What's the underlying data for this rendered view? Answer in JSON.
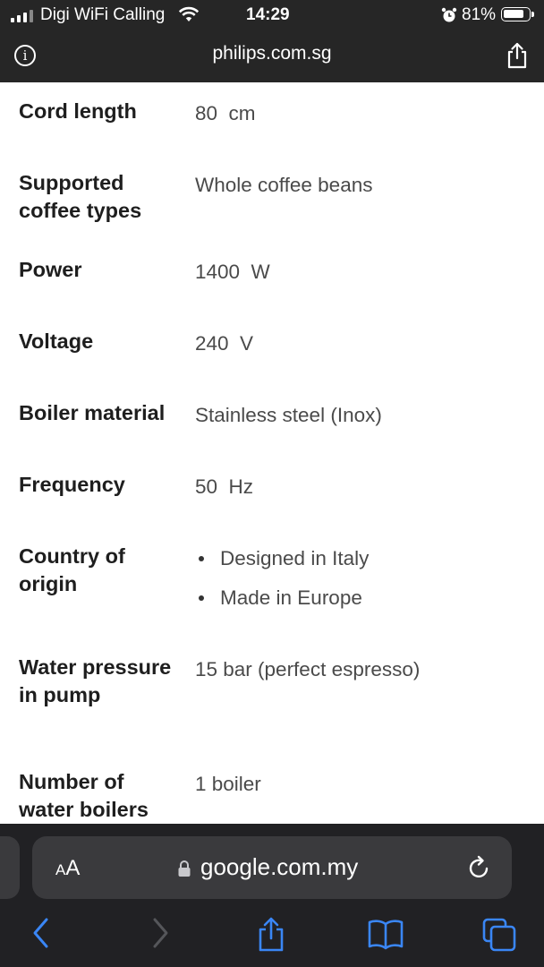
{
  "status": {
    "carrier": "Digi WiFi Calling",
    "time": "14:29",
    "battery": "81%",
    "battery_level": 0.81
  },
  "top_bar": {
    "domain": "philips.com.sg",
    "icons": [
      "info-icon",
      "share-icon"
    ]
  },
  "specs": [
    {
      "label": "Cord length",
      "value": "80  cm"
    },
    {
      "label": "Supported coffee types",
      "value": "Whole coffee beans"
    },
    {
      "label": "Power",
      "value": "1400  W"
    },
    {
      "label": "Voltage",
      "value": "240  V"
    },
    {
      "label": "Boiler material",
      "value": "Stainless steel (Inox)"
    },
    {
      "label": "Frequency",
      "value": "50  Hz"
    },
    {
      "label": "Country of origin",
      "values": [
        "Designed in Italy",
        "Made in Europe"
      ]
    },
    {
      "label": "Water pressure in pump",
      "value": "15 bar (perfect espresso)"
    },
    {
      "label": "Number of water boilers",
      "value": "1 boiler"
    }
  ],
  "address_bar": {
    "aa_small": "A",
    "aa_large": "A",
    "url": "google.com.my",
    "icons": [
      "lock-icon",
      "reload-icon"
    ]
  },
  "toolbar": {
    "icons": [
      "back-icon",
      "forward-icon",
      "share-icon",
      "bookmarks-icon",
      "tabs-icon"
    ]
  },
  "colors": {
    "bar_background": "#262626",
    "bottom_background": "#212124",
    "accent": "#3a86f5",
    "label_text": "#1e1e1e",
    "value_text": "#4a4a4a"
  }
}
